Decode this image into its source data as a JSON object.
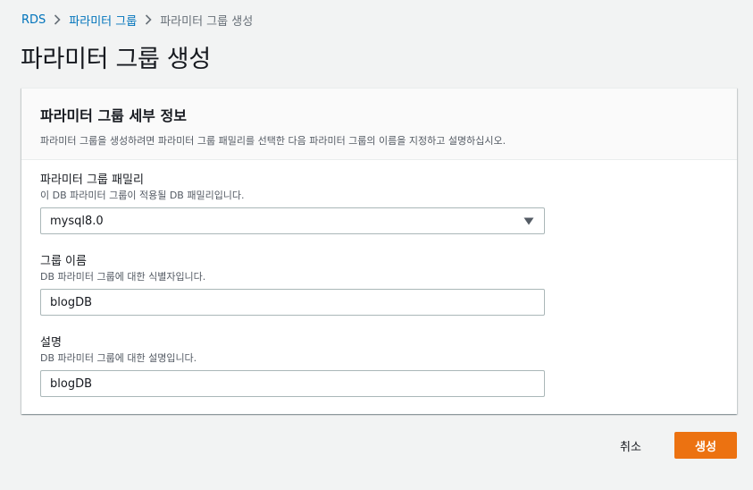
{
  "breadcrumb": {
    "items": [
      {
        "label": "RDS"
      },
      {
        "label": "파라미터 그룹"
      },
      {
        "label": "파라미터 그룹 생성"
      }
    ]
  },
  "page": {
    "title": "파라미터 그룹 생성"
  },
  "card": {
    "title": "파라미터 그룹 세부 정보",
    "description": "파라미터 그룹을 생성하려면 파라미터 그룹 패밀리를 선택한 다음 파라미터 그룹의 이름을 지정하고 설명하십시오."
  },
  "form": {
    "family": {
      "label": "파라미터 그룹 패밀리",
      "description": "이 DB 파라미터 그룹이 적용될 DB 패밀리입니다.",
      "value": "mysql8.0"
    },
    "group_name": {
      "label": "그룹 이름",
      "description": "DB 파라미터 그룹에 대한 식별자입니다.",
      "value": "blogDB"
    },
    "description_field": {
      "label": "설명",
      "description": "DB 파라미터 그룹에 대한 설명입니다.",
      "value": "blogDB"
    }
  },
  "actions": {
    "cancel_label": "취소",
    "create_label": "생성",
    "create_color": "#ec7211"
  },
  "icons": {
    "breadcrumb_separator": "chevron-right-icon",
    "select_caret": "caret-down-icon"
  },
  "colors": {
    "link": "#0073bb",
    "background": "#f2f3f3"
  }
}
